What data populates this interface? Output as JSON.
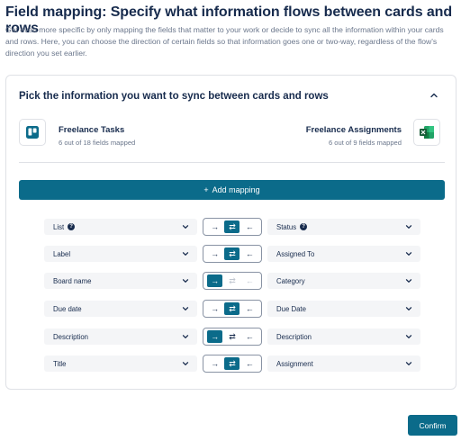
{
  "header": {
    "title": "Field mapping: Specify what information flows between cards and rows",
    "description": "Get even more specific by only mapping the fields that matter to your work or decide to sync all the information within your cards and rows. Here, you can choose the direction of certain fields so that information goes one or two-way, regardless of the flow's direction you set earlier."
  },
  "panel": {
    "title": "Pick the information you want to sync between cards and rows",
    "left_app": {
      "name": "Freelance Tasks",
      "sub": "6 out of 18 fields mapped",
      "icon": "trello-icon"
    },
    "right_app": {
      "name": "Freelance Assignments",
      "sub": "6 out of 9 fields mapped",
      "icon": "excel-icon"
    },
    "add_mapping_label": "Add mapping",
    "add_mapping_plus": "+"
  },
  "direction_glyphs": {
    "right": "→",
    "both": "⇄",
    "left": "←"
  },
  "mappings": [
    {
      "left": "List",
      "left_info": true,
      "right": "Status",
      "right_info": true,
      "direction": "both",
      "left_only_enabled": true,
      "disabled": []
    },
    {
      "left": "Label",
      "left_info": false,
      "right": "Assigned To",
      "right_info": false,
      "direction": "both",
      "disabled": []
    },
    {
      "left": "Board name",
      "left_info": false,
      "right": "Category",
      "right_info": false,
      "direction": "right",
      "disabled": [
        "both",
        "left"
      ]
    },
    {
      "left": "Due date",
      "left_info": false,
      "right": "Due Date",
      "right_info": false,
      "direction": "both",
      "disabled": []
    },
    {
      "left": "Description",
      "left_info": false,
      "right": "Description",
      "right_info": false,
      "direction": "right",
      "disabled": []
    },
    {
      "left": "Title",
      "left_info": false,
      "right": "Assignment",
      "right_info": false,
      "direction": "both",
      "disabled": []
    }
  ],
  "footer": {
    "confirm_label": "Confirm"
  },
  "colors": {
    "accent": "#0b6b8a",
    "text": "#172b4d",
    "muted": "#6b778c",
    "field_bg": "#f4f5f7",
    "border": "#dfe1e6"
  }
}
